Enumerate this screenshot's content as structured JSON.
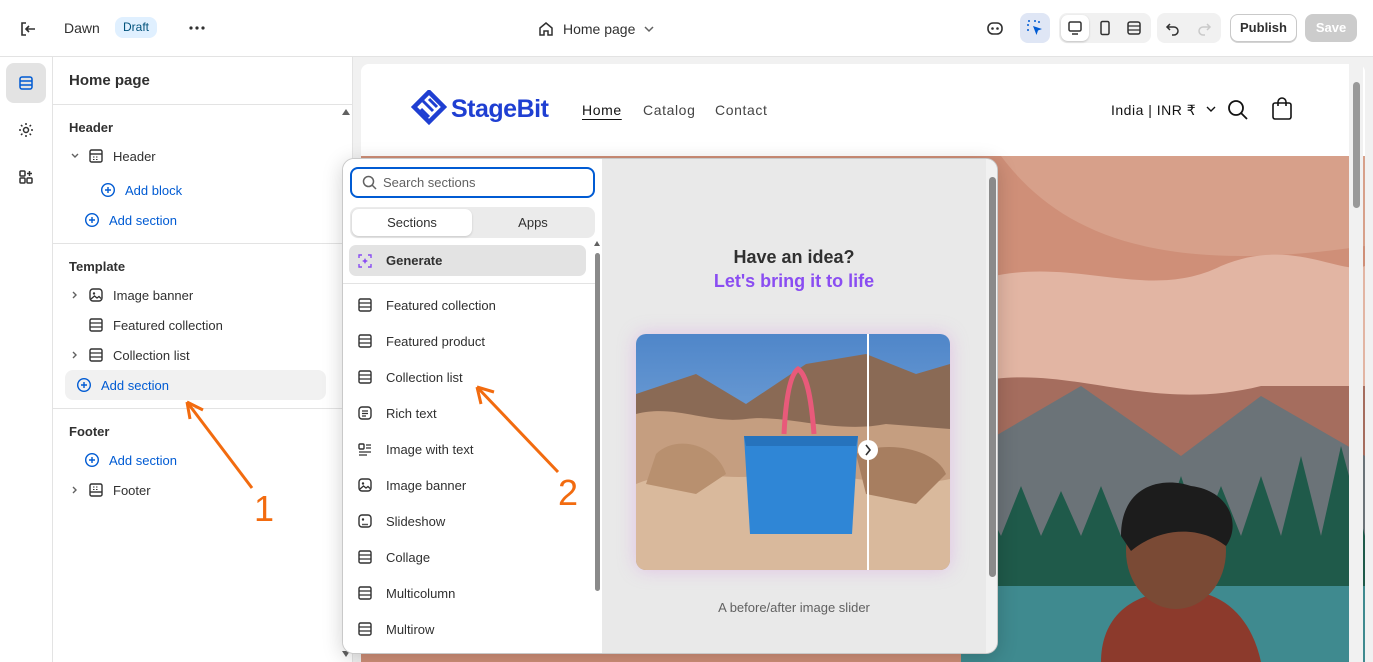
{
  "topbar": {
    "theme_name": "Dawn",
    "status_badge": "Draft",
    "more_label": "•••",
    "page_selector": "Home page",
    "publish_label": "Publish",
    "save_label": "Save"
  },
  "rail": {
    "items": [
      {
        "icon": "sections-icon",
        "active": true
      },
      {
        "icon": "gear-icon",
        "active": false
      },
      {
        "icon": "apps-icon",
        "active": false
      }
    ]
  },
  "sidebar": {
    "title": "Home page",
    "header_group": {
      "heading": "Header",
      "section": "Header",
      "add_block": "Add block",
      "add_section": "Add section"
    },
    "template_group": {
      "heading": "Template",
      "sections": [
        "Image banner",
        "Featured collection",
        "Collection list"
      ],
      "add_section": "Add section"
    },
    "footer_group": {
      "heading": "Footer",
      "add_section": "Add section",
      "section": "Footer"
    }
  },
  "storefront": {
    "logo_text": "StageBit",
    "nav": [
      "Home",
      "Catalog",
      "Contact"
    ],
    "country": "India | INR ₹"
  },
  "picker": {
    "search_placeholder": "Search sections",
    "tabs": [
      "Sections",
      "Apps"
    ],
    "generate_label": "Generate",
    "items": [
      {
        "label": "Featured collection",
        "icon": "section-icon"
      },
      {
        "label": "Featured product",
        "icon": "section-icon"
      },
      {
        "label": "Collection list",
        "icon": "section-icon"
      },
      {
        "label": "Rich text",
        "icon": "text-icon"
      },
      {
        "label": "Image with text",
        "icon": "image-text-icon"
      },
      {
        "label": "Image banner",
        "icon": "image-icon"
      },
      {
        "label": "Slideshow",
        "icon": "slideshow-icon"
      },
      {
        "label": "Collage",
        "icon": "section-icon"
      },
      {
        "label": "Multicolumn",
        "icon": "section-icon"
      },
      {
        "label": "Multirow",
        "icon": "section-icon"
      }
    ],
    "preview": {
      "title": "Have an idea?",
      "subtitle": "Let's bring it to life",
      "caption": "A before/after image slider"
    }
  },
  "annotations": {
    "one": "1",
    "two": "2",
    "color": "#f26b0f"
  },
  "colors": {
    "accent": "#005bd3",
    "generate_purple": "#8a4df2",
    "brand_blue": "#1f3fd2"
  }
}
